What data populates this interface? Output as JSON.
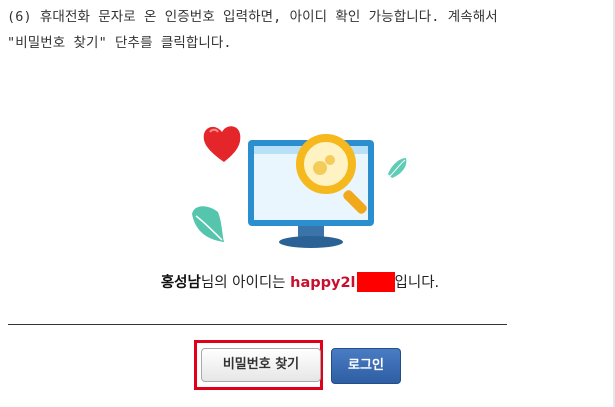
{
  "instruction": {
    "line1": "(6) 휴대전화 문자로 온 인증번호 입력하면, 아이디 확인 가능합니다. 계속해서",
    "line2": "\"비밀번호 찾기\" 단추를 클릭합니다."
  },
  "illustration": {
    "icons": [
      "heart-icon",
      "leaf-icon",
      "monitor-icon",
      "magnifier-icon"
    ],
    "colors": {
      "heart": "#e4262b",
      "leaf": "#4dbfa8",
      "monitor_frame": "#2b8fcf",
      "monitor_screen": "#e9f6fd",
      "magnifier": "#f5b91e"
    }
  },
  "result": {
    "name": "홍성남",
    "suffix_1": "님의 아이디는 ",
    "userid_visible": "happy2l",
    "suffix_2": "입니다."
  },
  "buttons": {
    "find_password": "비밀번호 찾기",
    "login": "로그인"
  },
  "colors": {
    "highlight_border": "#e0001a",
    "login_button": "#3a6db5",
    "userid_text": "#c8102e",
    "redaction": "#ff0000"
  }
}
